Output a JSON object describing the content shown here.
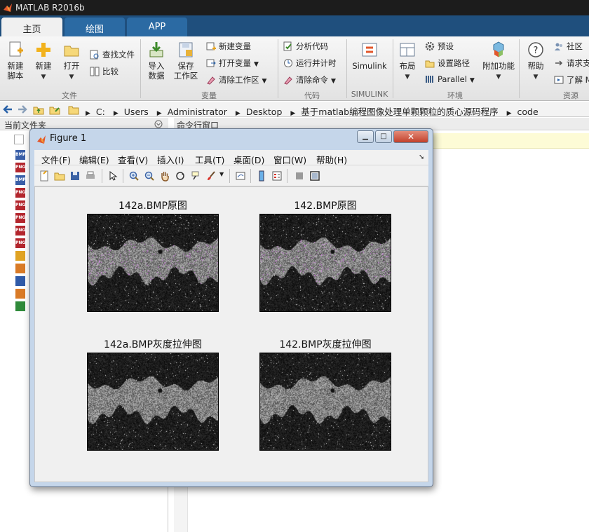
{
  "app": {
    "title": "MATLAB R2016b"
  },
  "tabs": [
    {
      "label": "主页",
      "active": true
    },
    {
      "label": "绘图",
      "active": false
    },
    {
      "label": "APP",
      "active": false
    }
  ],
  "ribbon": {
    "file": {
      "group": "文件",
      "new_script": "新建\n脚本",
      "new": "新建",
      "open": "打开",
      "find_files": "查找文件",
      "compare": "比较"
    },
    "variable": {
      "group": "变量",
      "import": "导入\n数据",
      "save_workspace": "保存\n工作区",
      "new_variable": "新建变量",
      "open_variable": "打开变量",
      "clear_workspace": "清除工作区"
    },
    "code": {
      "group": "代码",
      "analyze": "分析代码",
      "run_time": "运行并计时",
      "clear_commands": "清除命令"
    },
    "simulink": {
      "group": "SIMULINK",
      "label": "Simulink"
    },
    "environment": {
      "group": "环境",
      "layout": "布局",
      "preferences": "预设",
      "set_path": "设置路径",
      "parallel": "Parallel",
      "addons": "附加功能"
    },
    "resources": {
      "group": "资源",
      "help": "帮助",
      "community": "社区",
      "request_support": "请求支",
      "learn": "了解 M"
    }
  },
  "address": {
    "crumbs": [
      "C:",
      "Users",
      "Administrator",
      "Desktop",
      "基于matlab编程图像处理单颗颗粒的质心源码程序",
      "code"
    ]
  },
  "panels": {
    "current_folder": "当前文件夹",
    "command_window": "命令行窗口"
  },
  "file_icons": [
    "BMP",
    "PNG",
    "BMP",
    "PNG",
    "PNG",
    "PNG",
    "PNG",
    "PNG",
    "M",
    "FIG",
    "DOC",
    "FIG",
    "XLS"
  ],
  "figure": {
    "title": "Figure 1",
    "menu": [
      "文件(F)",
      "编辑(E)",
      "查看(V)",
      "插入(I)",
      "工具(T)",
      "桌面(D)",
      "窗口(W)",
      "帮助(H)"
    ],
    "axes": [
      {
        "title": "142a.BMP原图",
        "tinted": true
      },
      {
        "title": "142.BMP原图",
        "tinted": true
      },
      {
        "title": "142a.BMP灰度拉伸图",
        "tinted": false
      },
      {
        "title": "142.BMP灰度拉伸图",
        "tinted": false
      }
    ]
  },
  "colors": {
    "tab_strip": "#1f4f7d",
    "accent": "#2b6aa3",
    "figure_frame": "#c5d6ea"
  }
}
